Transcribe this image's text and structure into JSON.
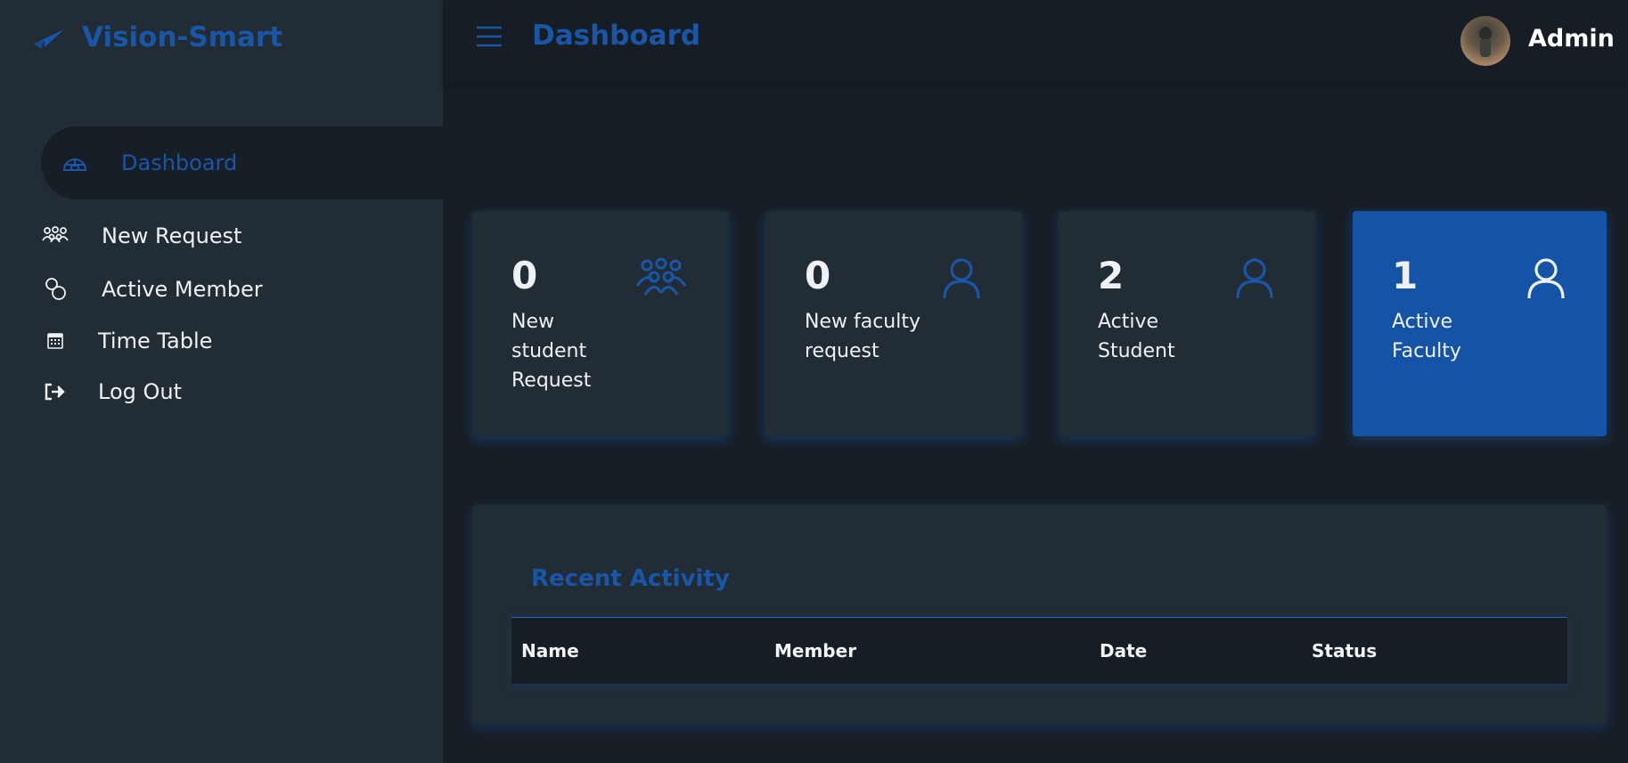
{
  "brand": {
    "name": "Vision-Smart",
    "logo_icon": "paper-plane-icon"
  },
  "header": {
    "title": "Dashboard",
    "menu_icon": "hamburger-icon",
    "user_name": "Admin"
  },
  "sidebar": {
    "items": [
      {
        "label": "Dashboard",
        "icon": "igloo-icon",
        "active": true
      },
      {
        "label": "New Request",
        "icon": "users-icon"
      },
      {
        "label": "Active Member",
        "icon": "user-pair-icon"
      },
      {
        "label": "Time Table",
        "icon": "calendar-icon"
      },
      {
        "label": "Log Out",
        "icon": "sign-out-icon"
      }
    ]
  },
  "cards": [
    {
      "value": "0",
      "label": "New student Request",
      "icon": "users-icon"
    },
    {
      "value": "0",
      "label": "New faculty request",
      "icon": "user-icon"
    },
    {
      "value": "2",
      "label": "Active Student",
      "icon": "user-icon"
    },
    {
      "value": "1",
      "label": "Active Faculty",
      "icon": "user-icon"
    }
  ],
  "activity": {
    "title": "Recent Activity",
    "columns": [
      "Name",
      "Member",
      "Date",
      "Status"
    ]
  },
  "colors": {
    "accent": "#1a56a8",
    "sidebar": "#212c35",
    "background": "#171e26",
    "highlight_card": "#1453a5"
  }
}
